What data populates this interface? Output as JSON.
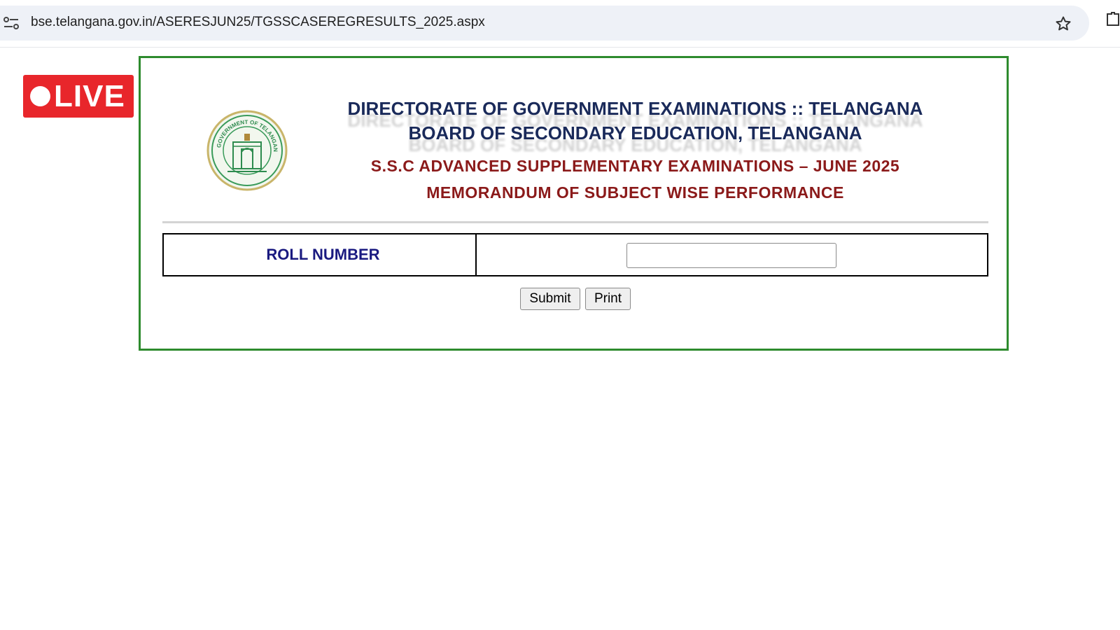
{
  "browser": {
    "url": "bse.telangana.gov.in/ASERESJUN25/TGSSCASEREGRESULTS_2025.aspx"
  },
  "badge": {
    "label": "LIVE",
    "color": "#e8262b"
  },
  "header": {
    "line1": "DIRECTORATE OF GOVERNMENT EXAMINATIONS :: TELANGANA",
    "line2": "BOARD OF SECONDARY EDUCATION, TELANGANA",
    "line3": "S.S.C ADVANCED SUPPLEMENTARY EXAMINATIONS – JUNE 2025",
    "line4": "MEMORANDUM OF SUBJECT WISE PERFORMANCE",
    "emblem_text": "GOVERNMENT OF TELANGANA"
  },
  "form": {
    "roll_label": "ROLL NUMBER",
    "roll_value": "",
    "submit_label": "Submit",
    "print_label": "Print"
  },
  "colors": {
    "frame_border": "#2e8b2e",
    "header_blue": "#1a2a5a",
    "header_red": "#8b1a1a",
    "label_blue": "#1a1a80"
  }
}
